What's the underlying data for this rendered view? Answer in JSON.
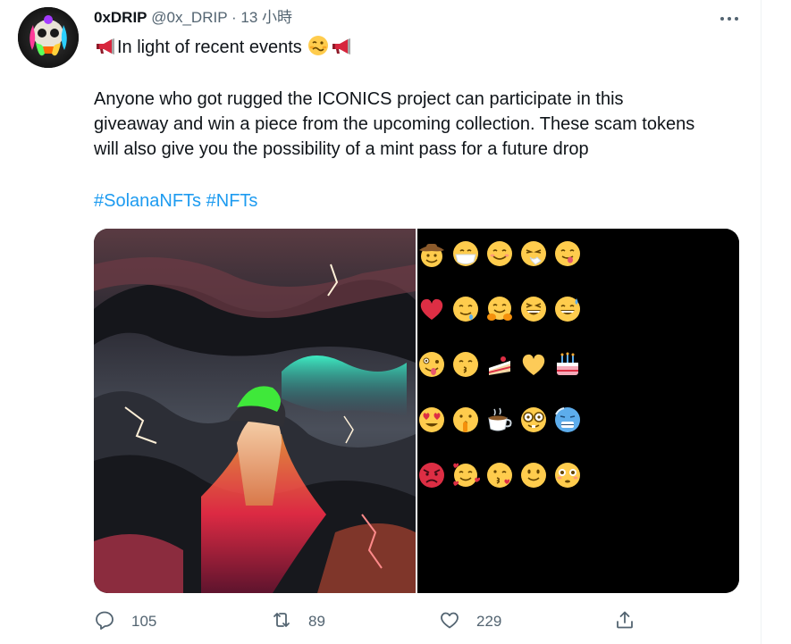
{
  "tweet": {
    "display_name": "0xDRIP",
    "handle": "@0x_DRIP",
    "separator": "·",
    "time": "13 小時",
    "line1_text": "In light of recent events",
    "body_line1": "Anyone who got rugged the ICONICS project can participate in this",
    "body_line2": "giveaway and win a piece from the upcoming collection. These scam tokens",
    "body_line3": "will also give you the possibility of a mint pass for a future  drop",
    "hashtag1": "#SolanaNFTs",
    "hashtag2": "#NFTs"
  },
  "actions": {
    "replies": "105",
    "retweets": "89",
    "likes": "229"
  },
  "icons": {
    "more": "more-horizontal-icon",
    "reply": "reply-icon",
    "retweet": "retweet-icon",
    "like": "heart-icon",
    "share": "share-icon"
  },
  "colors": {
    "hashtag": "#1d9bf0",
    "secondary_text": "#536471",
    "primary_text": "#0f1419"
  }
}
